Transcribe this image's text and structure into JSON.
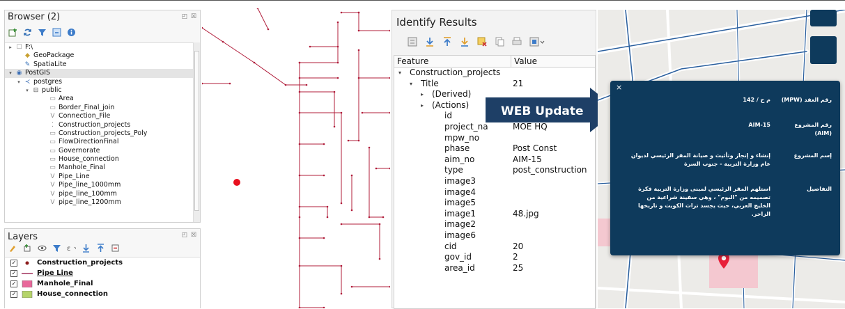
{
  "browser": {
    "title": "Browser (2)",
    "ctrl": "◰ ☒",
    "toolbar_icons": [
      "add-layer-icon",
      "refresh-icon",
      "filter-icon",
      "collapse-icon",
      "info-icon"
    ],
    "tree": [
      {
        "label": "F:\\",
        "indent": 0,
        "arrow": "▸",
        "icon": "folder-icon"
      },
      {
        "label": "GeoPackage",
        "indent": 1,
        "arrow": "",
        "icon": "geopackage-icon"
      },
      {
        "label": "SpatiaLite",
        "indent": 1,
        "arrow": "",
        "icon": "spatialite-icon"
      },
      {
        "label": "PostGIS",
        "indent": 0,
        "arrow": "▾",
        "icon": "postgis-icon",
        "selected": true
      },
      {
        "label": "postgres",
        "indent": 1,
        "arrow": "▾",
        "icon": "connection-icon"
      },
      {
        "label": "public",
        "indent": 2,
        "arrow": "▾",
        "icon": "schema-icon"
      },
      {
        "label": "Area",
        "indent": 4,
        "arrow": "",
        "icon": "polygon-layer-icon"
      },
      {
        "label": "Border_Final_join",
        "indent": 4,
        "arrow": "",
        "icon": "polygon-layer-icon"
      },
      {
        "label": "Connection_File",
        "indent": 4,
        "arrow": "",
        "icon": "line-layer-icon"
      },
      {
        "label": "Construction_projects",
        "indent": 4,
        "arrow": "",
        "icon": "point-layer-icon"
      },
      {
        "label": "Construction_projects_Poly",
        "indent": 4,
        "arrow": "",
        "icon": "polygon-layer-icon"
      },
      {
        "label": "FlowDirectionFinal",
        "indent": 4,
        "arrow": "",
        "icon": "polygon-layer-icon"
      },
      {
        "label": "Governorate",
        "indent": 4,
        "arrow": "",
        "icon": "polygon-layer-icon"
      },
      {
        "label": "House_connection",
        "indent": 4,
        "arrow": "",
        "icon": "polygon-layer-icon"
      },
      {
        "label": "Manhole_Final",
        "indent": 4,
        "arrow": "",
        "icon": "polygon-layer-icon"
      },
      {
        "label": "Pipe_Line",
        "indent": 4,
        "arrow": "",
        "icon": "line-layer-icon"
      },
      {
        "label": "Pipe_line_1000mm",
        "indent": 4,
        "arrow": "",
        "icon": "line-layer-icon"
      },
      {
        "label": "pipe_line_100mm",
        "indent": 4,
        "arrow": "",
        "icon": "line-layer-icon"
      },
      {
        "label": "pipe_line_1200mm",
        "indent": 4,
        "arrow": "",
        "icon": "line-layer-icon"
      }
    ]
  },
  "layers": {
    "title": "Layers",
    "ctrl": "◰ ☒",
    "items": [
      {
        "label": "Construction_projects",
        "symbol": "point",
        "color": "#8b1a1a",
        "checked": true,
        "underline": false
      },
      {
        "label": "Pipe Line",
        "symbol": "line",
        "color": "#a0305a",
        "checked": true,
        "underline": true
      },
      {
        "label": "Manhole_Final",
        "symbol": "fill",
        "color": "#e8679a",
        "checked": true,
        "underline": false
      },
      {
        "label": "House_connection",
        "symbol": "fill",
        "color": "#b5d46a",
        "checked": true,
        "underline": false
      }
    ]
  },
  "identify": {
    "title": "Identify Results",
    "col_feature": "Feature",
    "col_value": "Value",
    "rows": [
      {
        "feature": "Construction_projects",
        "value": "",
        "indent": 0,
        "arrow": "▾"
      },
      {
        "feature": "Title",
        "value": "21",
        "indent": 1,
        "arrow": "▾"
      },
      {
        "feature": "(Derived)",
        "value": "",
        "indent": 2,
        "arrow": "▸"
      },
      {
        "feature": "(Actions)",
        "value": "",
        "indent": 2,
        "arrow": "▸"
      },
      {
        "feature": "id",
        "value": "",
        "indent": 3,
        "arrow": ""
      },
      {
        "feature": "project_na",
        "value": "MOE HQ",
        "indent": 3,
        "arrow": ""
      },
      {
        "feature": "mpw_no",
        "value": "",
        "indent": 3,
        "arrow": ""
      },
      {
        "feature": "phase",
        "value": "Post Const",
        "indent": 3,
        "arrow": ""
      },
      {
        "feature": "aim_no",
        "value": "AIM-15",
        "indent": 3,
        "arrow": ""
      },
      {
        "feature": "type",
        "value": "post_construction",
        "indent": 3,
        "arrow": ""
      },
      {
        "feature": "image3",
        "value": "",
        "indent": 3,
        "arrow": ""
      },
      {
        "feature": "image4",
        "value": "",
        "indent": 3,
        "arrow": ""
      },
      {
        "feature": "image5",
        "value": "",
        "indent": 3,
        "arrow": ""
      },
      {
        "feature": "image1",
        "value": "48.jpg",
        "indent": 3,
        "arrow": ""
      },
      {
        "feature": "image2",
        "value": "",
        "indent": 3,
        "arrow": ""
      },
      {
        "feature": "image6",
        "value": "",
        "indent": 3,
        "arrow": ""
      },
      {
        "feature": "cid",
        "value": "20",
        "indent": 3,
        "arrow": ""
      },
      {
        "feature": "gov_id",
        "value": "2",
        "indent": 3,
        "arrow": ""
      },
      {
        "feature": "area_id",
        "value": "25",
        "indent": 3,
        "arrow": ""
      }
    ]
  },
  "web_update": {
    "label": "WEB Update",
    "color": "#1e3f66"
  },
  "popup": {
    "close": "×",
    "rows": [
      {
        "key": "رقم العقد (MPW)",
        "value": "م ح / 142"
      },
      {
        "key": "رقم المشروع (AIM)",
        "value": "AIM-15"
      },
      {
        "key": "إسم المشروع",
        "value": "إنشاء و إنجاز وتأثيث و صيانة المقر الرئيسي لديوان عام وزارة التربية - جنوب السرة"
      },
      {
        "key": "التفاصيل",
        "value": "استلهم المقر الرئيسي لمبنى وزارة التربية فكرة تصميمه من \"البوم\" ، وهي سفينة شراعية من الخليج العربي، حيث يجسد تراث الكويت و تاريخها الزاخر."
      }
    ],
    "bg_color": "#0e3a5c"
  }
}
